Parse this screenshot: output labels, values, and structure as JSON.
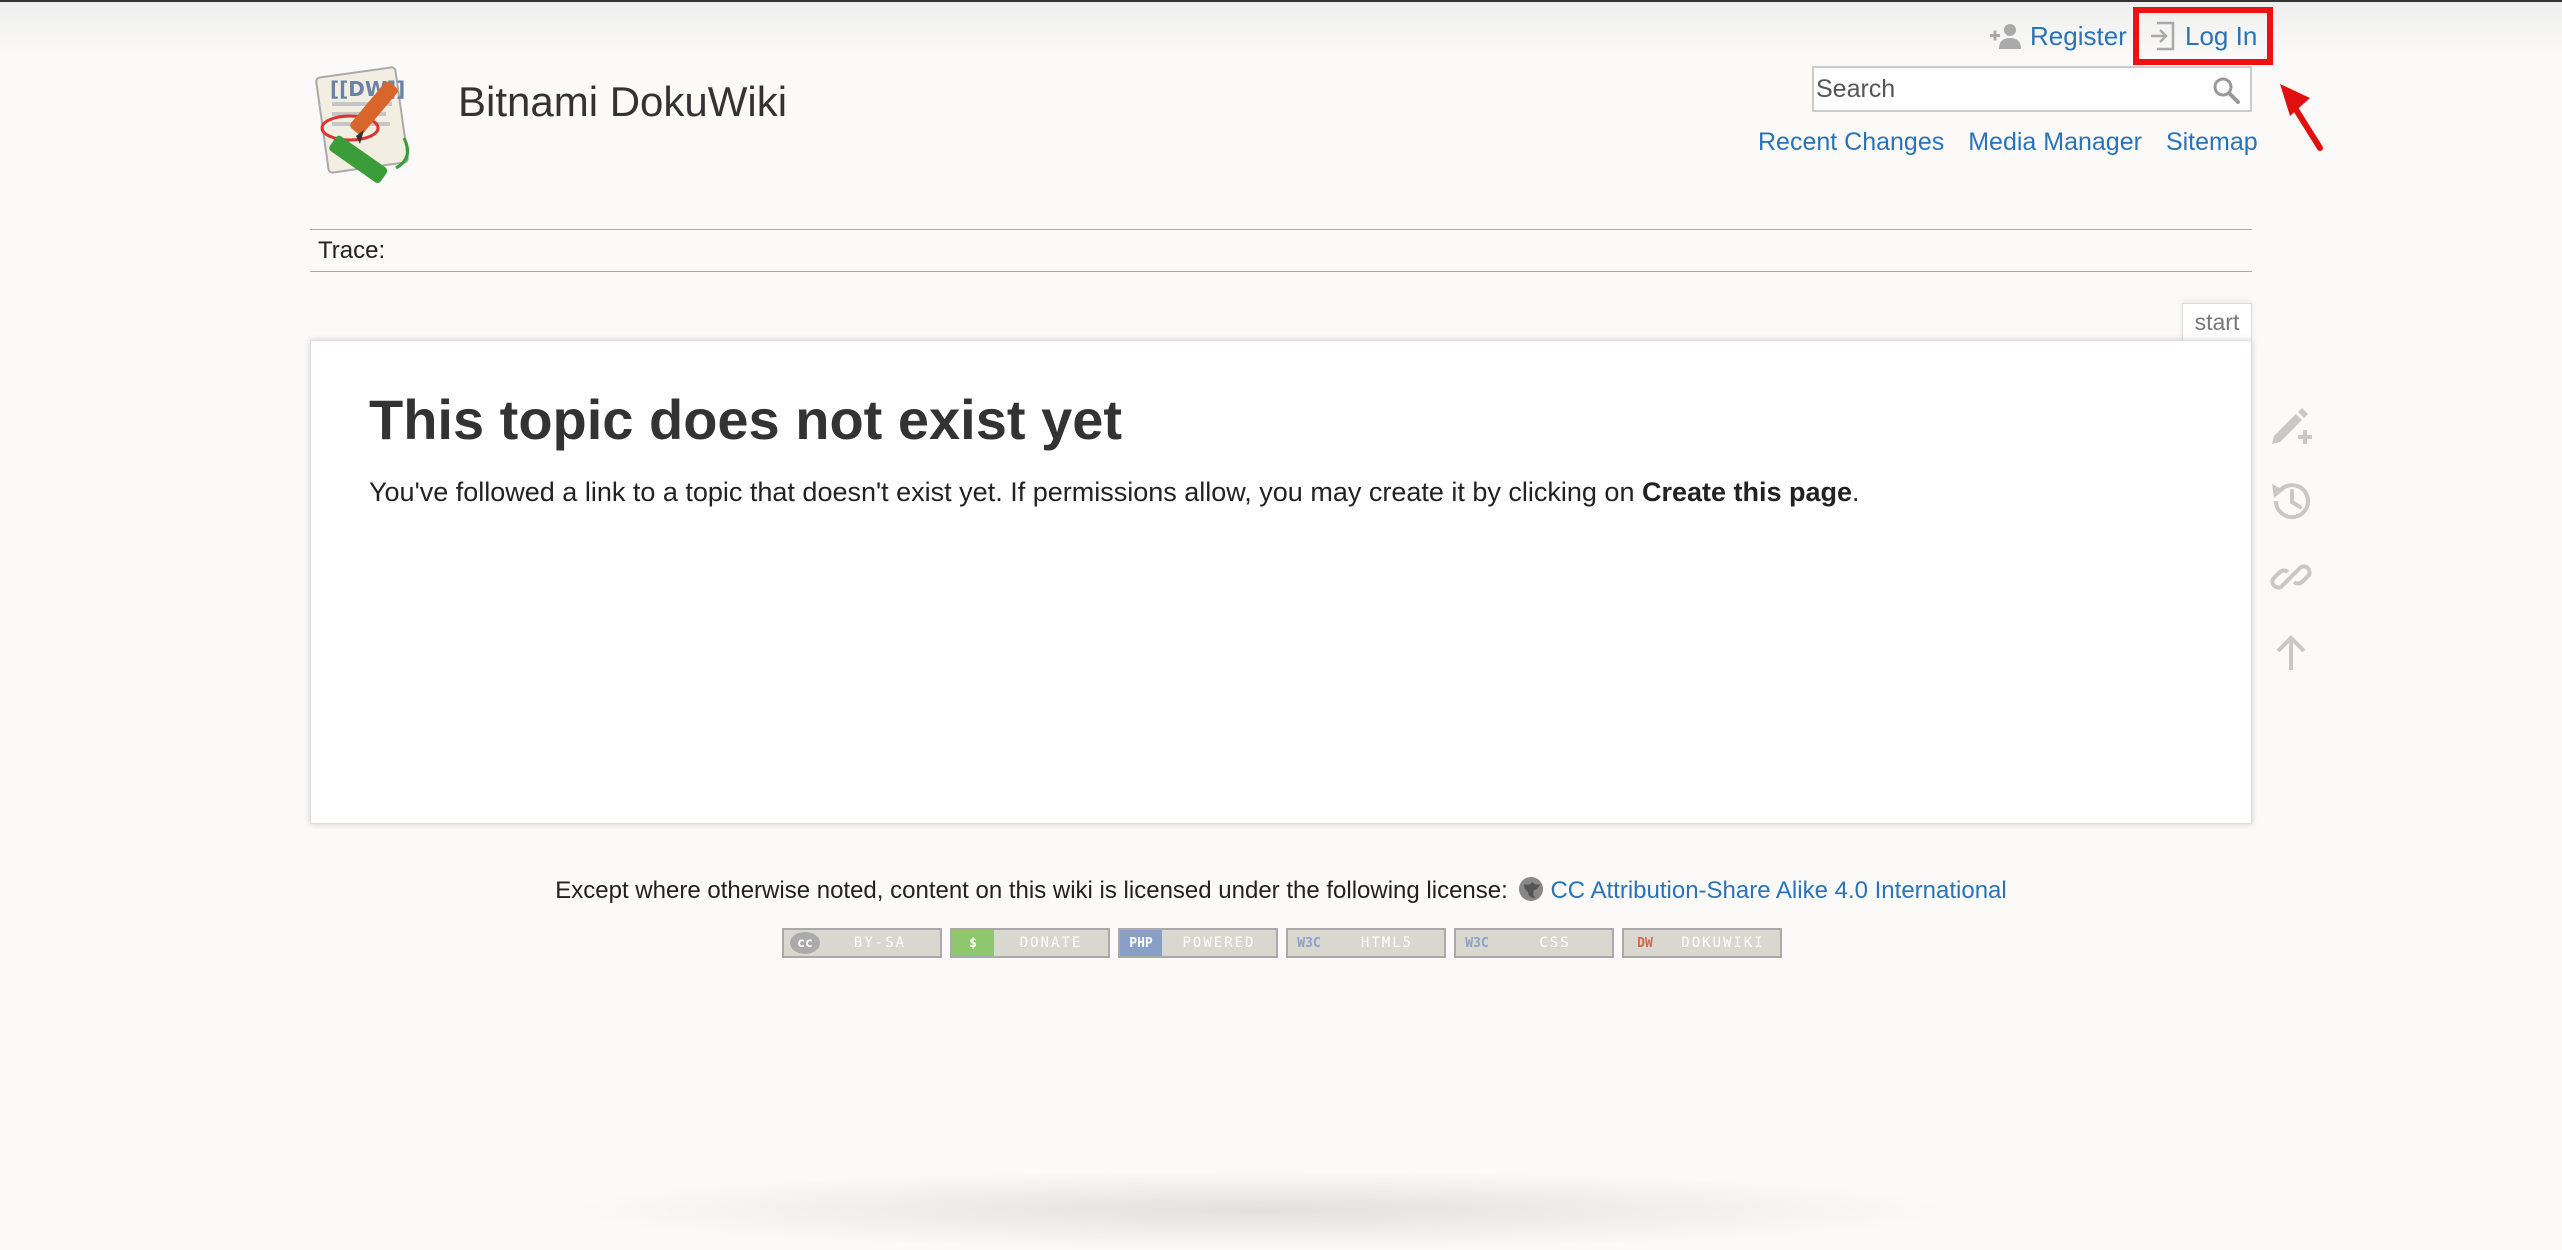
{
  "site": {
    "title": "Bitnami DokuWiki",
    "logo_icon": "dokuwiki-logo-icon"
  },
  "user_tools": {
    "register_label": "Register",
    "login_label": "Log In"
  },
  "search": {
    "placeholder": "Search",
    "value": ""
  },
  "site_tools": [
    {
      "label": "Recent Changes"
    },
    {
      "label": "Media Manager"
    },
    {
      "label": "Sitemap"
    }
  ],
  "breadcrumbs": {
    "label": "Trace:"
  },
  "page": {
    "id": "start",
    "heading": "This topic does not exist yet",
    "body_prefix": "You've followed a link to a topic that doesn't exist yet. If permissions allow, you may create it by clicking on ",
    "body_bold": "Create this page",
    "body_suffix": "."
  },
  "page_tools": [
    {
      "icon": "create-page-icon"
    },
    {
      "icon": "old-revisions-icon"
    },
    {
      "icon": "backlinks-icon"
    },
    {
      "icon": "back-to-top-icon"
    }
  ],
  "footer": {
    "license_text": "Except where otherwise noted, content on this wiki is licensed under the following license:",
    "license_link": "CC Attribution-Share Alike 4.0 International",
    "badges": [
      {
        "lead": "cc",
        "text": "BY-SA",
        "lead_color": "#aaaaaa"
      },
      {
        "lead": "$",
        "text": "DONATE",
        "lead_color": "#8fc76f"
      },
      {
        "lead": "PHP",
        "text": "POWERED",
        "lead_color": "#8a9fc8"
      },
      {
        "lead": "W3C",
        "text": "HTML5",
        "lead_color": "#d8d8d0"
      },
      {
        "lead": "W3C",
        "text": "CSS",
        "lead_color": "#d8d8d0"
      },
      {
        "lead": "DW",
        "text": "DOKUWIKI",
        "lead_color": "#c8c8c0"
      }
    ]
  },
  "colors": {
    "link": "#2b73b7",
    "highlight_box": "#ee1111",
    "background": "#fbfaf9"
  }
}
